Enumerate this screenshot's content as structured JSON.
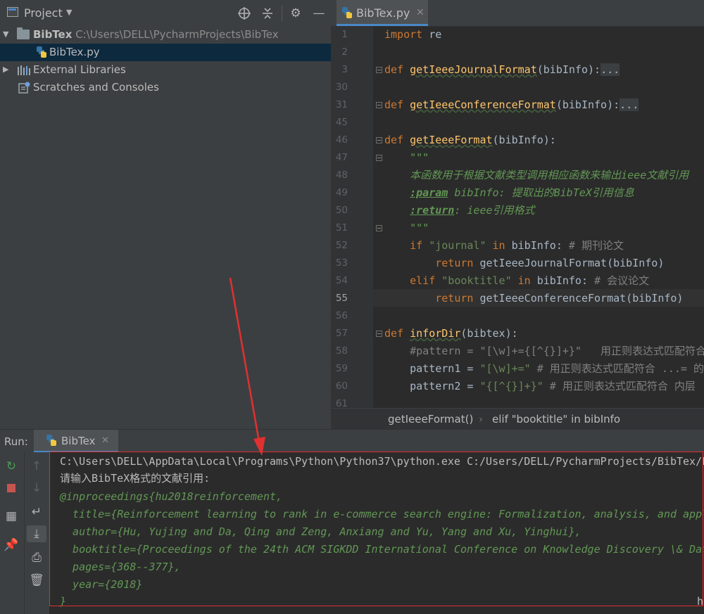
{
  "project_panel": {
    "title": "Project",
    "tree": [
      {
        "label": "BibTex",
        "path": "C:\\Users\\DELL\\PycharmProjects\\BibTex"
      },
      {
        "label": "BibTex.py"
      },
      {
        "label": "External Libraries"
      },
      {
        "label": "Scratches and Consoles"
      }
    ]
  },
  "editor": {
    "tab_label": "BibTex.py",
    "line_numbers": [
      "1",
      "2",
      "3",
      "30",
      "31",
      "45",
      "46",
      "47",
      "48",
      "49",
      "50",
      "51",
      "52",
      "53",
      "54",
      "55",
      "56",
      "57",
      "58",
      "59",
      "60",
      "61"
    ],
    "breadcrumb": [
      "getIeeeFormat()",
      "elif \"booktitle\" in bibInfo"
    ]
  },
  "code": {
    "l1_kw": "import",
    "l1_rest": " re",
    "l3_kw": "def ",
    "l3_fn": "getIeeeJournalFormat",
    "l3_args": "(bibInfo):",
    "l3_fold": "...",
    "l31_kw": "def ",
    "l31_fn": "getIeeeConferenceFormat",
    "l31_args": "(bibInfo):",
    "l31_fold": "...",
    "l46_kw": "def ",
    "l46_fn": "getIeeeFormat",
    "l46_args": "(bibInfo):",
    "l47": "    \"\"\"",
    "l48": "    本函数用于根据文献类型调用相应函数来输出ieee文献引用",
    "l49_tag": ":param",
    "l49_rest": " bibInfo: 提取出的BibTeX引用信息",
    "l50_tag": ":return",
    "l50_rest": ": ieee引用格式",
    "l51": "    \"\"\"",
    "l52_kw": "if ",
    "l52_str": "\"journal\"",
    "l52_kw2": " in ",
    "l52_rest": "bibInfo: ",
    "l52_cm": "# 期刊论文",
    "l53_kw": "return ",
    "l53_rest": "getIeeeJournalFormat(bibInfo)",
    "l54_kw": "elif ",
    "l54_str": "\"booktitle\"",
    "l54_kw2": " in ",
    "l54_rest": "bibInfo: ",
    "l54_cm": "# 会议论文",
    "l55_kw": "return ",
    "l55_rest": "getIeeeConferenceFormat(bibInfo)",
    "l57_kw": "def ",
    "l57_fn": "inforDir",
    "l57_args": "(bibtex):",
    "l58_cm": "#pattern = \"[\\w]+={[^{}]+}\"   用正则表达式匹配符合",
    "l59_var": "pattern1 = ",
    "l59_str": "\"[\\w]+=\"",
    "l59_cm": " # 用正则表达式匹配符合 ...= 的",
    "l60_var": "pattern2 = ",
    "l60_str": "\"{[^{}]+}\"",
    "l60_cm": " # 用正则表达式匹配符合 内层"
  },
  "run_panel": {
    "label": "Run:",
    "tab_label": "BibTex"
  },
  "console": {
    "command": "C:\\Users\\DELL\\AppData\\Local\\Programs\\Python\\Python37\\python.exe C:/Users/DELL/PycharmProjects/BibTex/E",
    "prompt": "请输入BibTeX格式的文献引用:",
    "input_lines": [
      "@inproceedings{hu2018reinforcement,",
      "  title={Reinforcement learning to rank in e-commerce search engine: Formalization, analysis, and appl",
      "  author={Hu, Yujing and Da, Qing and Zeng, Anxiang and Yu, Yang and Xu, Yinghui},",
      "  booktitle={Proceedings of the 24th ACM SIGKDD International Conference on Knowledge Discovery \\& Dat",
      "  pages={368--377},",
      "  year={2018}",
      "}"
    ],
    "trailing": "h"
  },
  "colors": {
    "keyword": "#cc7832",
    "function": "#ffc66d",
    "string": "#6a8759",
    "comment": "#808080",
    "docstring": "#629755",
    "annotation": "#e03030",
    "accent": "#4a88c7"
  }
}
